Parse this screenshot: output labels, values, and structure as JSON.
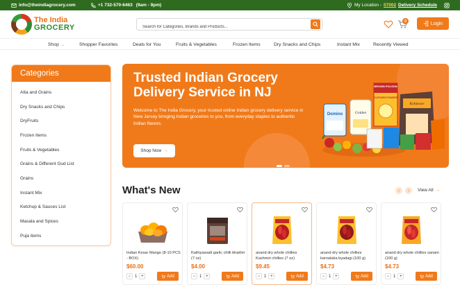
{
  "topbar": {
    "email": "info@theindiagrocery.com",
    "phone": "+1 732-570-6463",
    "hours": "(9am - 9pm)",
    "location_label": "My Location -",
    "location_code": "07002",
    "delivery_schedule": "Delivery Schedule"
  },
  "header": {
    "logo_line1": "The India",
    "logo_line2": "GROCERY",
    "search_placeholder": "Search for Categories, Brands and Products...",
    "cart_count": "0",
    "login_label": "Login"
  },
  "nav": {
    "items": [
      {
        "label": "Shop"
      },
      {
        "label": "Shopper Favorites"
      },
      {
        "label": "Deals for You"
      },
      {
        "label": "Fruits & Vegetables"
      },
      {
        "label": "Frozen Items"
      },
      {
        "label": "Dry Snacks and Chips"
      },
      {
        "label": "Instant Mix"
      },
      {
        "label": "Recently Viewed"
      }
    ]
  },
  "sidebar": {
    "title": "Categories",
    "items": [
      {
        "label": "Atta and Grains"
      },
      {
        "label": "Dry Snacks and Chips"
      },
      {
        "label": "DryFruits"
      },
      {
        "label": "Frozen Items"
      },
      {
        "label": "Fruits & Vegetables"
      },
      {
        "label": "Grains & Different Gud List"
      },
      {
        "label": "Grains"
      },
      {
        "label": "Instant Mix"
      },
      {
        "label": "Ketchup & Sauces List"
      },
      {
        "label": "Masala and Spices"
      },
      {
        "label": "Puja items"
      }
    ]
  },
  "hero": {
    "title": "Trusted Indian Grocery Delivery Service in NJ",
    "text": "Welcome to The India Grocery, your trusted online Indian grocery delivery service in New Jersey bringing Indian groceries to you, from everyday staples to authentic Indian flavors.",
    "button": "Shop Now",
    "product_labels": [
      "Domino",
      "Golden",
      "BROWN POLSON",
      "CUSTARD POWDER",
      "Kohinoor"
    ]
  },
  "whats_new": {
    "title": "What's New",
    "view_all": "View All",
    "products": [
      {
        "name": "Indian Kesar Mango (8-10 PCS - BOX)",
        "price": "$60.00",
        "qty": "1",
        "add": "Add"
      },
      {
        "name": "Kathiyawadi garlic chilli bhakhri (7 oz)",
        "price": "$4.00",
        "qty": "1",
        "add": "Add"
      },
      {
        "name": "anand dry whole chillies Kashmiri chillies (7 oz)",
        "price": "$9.45",
        "qty": "1",
        "add": "Add"
      },
      {
        "name": "anand dry whole chillies karnataka byadagi (100 g)",
        "price": "$4.73",
        "qty": "1",
        "add": "Add"
      },
      {
        "name": "anand dry whole chillies sanam (100 g)",
        "price": "$4.73",
        "qty": "1",
        "add": "Add"
      }
    ]
  },
  "colors": {
    "accent": "#f07a1a",
    "topbar": "#2e6b1e",
    "brand_green": "#2e8b2e"
  }
}
